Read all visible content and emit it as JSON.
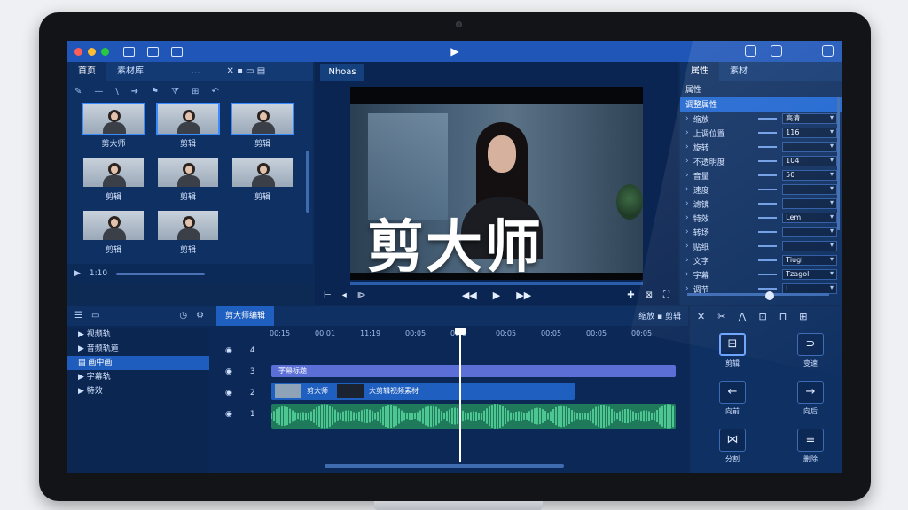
{
  "app": {
    "overlay_title": "剪大师",
    "logo_glyph": "▶"
  },
  "media_panel": {
    "tabs": [
      "首页",
      "素材库"
    ],
    "more": "...",
    "clips": [
      {
        "label": "剪大师",
        "selected": true
      },
      {
        "label": "剪辑",
        "selected": true
      },
      {
        "label": "剪辑",
        "selected": true
      },
      {
        "label": "剪辑",
        "selected": false
      },
      {
        "label": "剪辑",
        "selected": false
      },
      {
        "label": "剪辑",
        "selected": false
      },
      {
        "label": "剪辑",
        "selected": false
      },
      {
        "label": "剪辑",
        "selected": false
      }
    ],
    "footer_time": "1:10"
  },
  "viewer": {
    "tab": "Nhoas"
  },
  "inspector": {
    "tabs": [
      "属性",
      "素材"
    ],
    "section_label": "属性",
    "selected_label": "调整属性",
    "rows": [
      {
        "name": "缩放",
        "value": "高清"
      },
      {
        "name": "上调位置",
        "value": "116"
      },
      {
        "name": "旋转",
        "value": ""
      },
      {
        "name": "不透明度",
        "value": "104"
      },
      {
        "name": "音量",
        "value": "50"
      },
      {
        "name": "速度",
        "value": ""
      },
      {
        "name": "滤镜",
        "value": ""
      },
      {
        "name": "特效",
        "value": "Lem"
      },
      {
        "name": "转场",
        "value": ""
      },
      {
        "name": "贴纸",
        "value": ""
      },
      {
        "name": "文字",
        "value": "Tiugl"
      },
      {
        "name": "字幕",
        "value": "Tzagol"
      },
      {
        "name": "调节",
        "value": "L"
      }
    ]
  },
  "timeline": {
    "tab_active": "剪大师编辑",
    "right_label": "缩放 ▪ 剪辑",
    "tree": [
      {
        "label": "▶ 视频轨",
        "active": false
      },
      {
        "label": "▶ 音频轨道",
        "active": false
      },
      {
        "label": "▤ 画中画",
        "active": true
      },
      {
        "label": "▶ 字幕轨",
        "active": false
      },
      {
        "label": "▶ 特效",
        "active": false
      }
    ],
    "track_numbers": [
      "4",
      "3",
      "2",
      "1"
    ],
    "ruler": [
      "00:15",
      "00:01",
      "11:19",
      "00:05",
      "00:0",
      "00:05",
      "00:05",
      "00:05",
      "00:05"
    ],
    "title_clip": "字幕标题",
    "video_clip_a": "剪大师",
    "video_clip_b": "大剪辑视频素材"
  },
  "tools": {
    "items": [
      {
        "icon": "⊟",
        "label": "剪辑",
        "selected": true
      },
      {
        "icon": "⊃",
        "label": "变速",
        "selected": false
      },
      {
        "icon": "←",
        "label": "向前",
        "selected": false
      },
      {
        "icon": "→",
        "label": "向后",
        "selected": false
      },
      {
        "icon": "⋈",
        "label": "分割",
        "selected": false
      },
      {
        "icon": "≡",
        "label": "删除",
        "selected": false
      }
    ]
  },
  "colors": {
    "accent": "#1f66d1",
    "titlebar": "#1f56b8",
    "panel": "#0f3062",
    "audio_clip": "#1f7a5c",
    "title_clip": "#5b6fd6"
  }
}
